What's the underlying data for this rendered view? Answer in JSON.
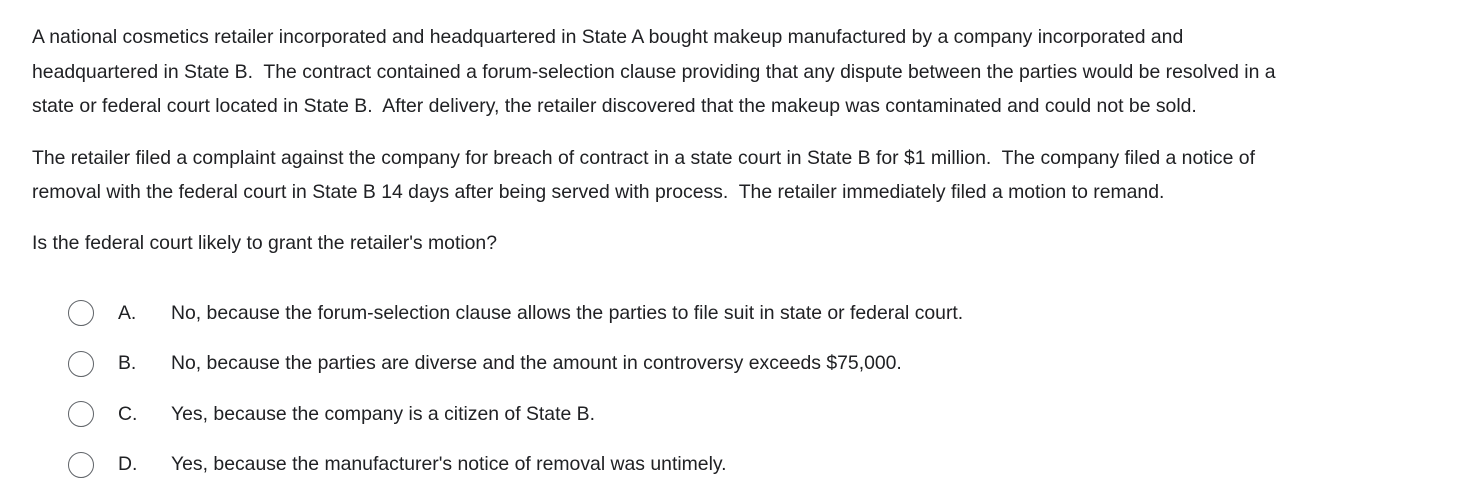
{
  "question": {
    "paragraphs": [
      "A national cosmetics retailer incorporated and headquartered in State A bought makeup manufactured by a company incorporated and\nheadquartered in State B.  The contract contained a forum-selection clause providing that any dispute between the parties would be resolved in a\nstate or federal court located in State B.  After delivery, the retailer discovered that the makeup was contaminated and could not be sold.",
      "The retailer filed a complaint against the company for breach of contract in a state court in State B for $1 million.  The company filed a notice of\nremoval with the federal court in State B 14 days after being served with process.  The retailer immediately filed a motion to remand."
    ],
    "prompt": "Is the federal court likely to grant the retailer's motion?"
  },
  "options": [
    {
      "letter": "A.",
      "text": "No, because the forum-selection clause allows the parties to file suit in state or federal court."
    },
    {
      "letter": "B.",
      "text": "No, because the parties are diverse and the amount in controversy exceeds $75,000."
    },
    {
      "letter": "C.",
      "text": "Yes, because the company is a citizen of State B."
    },
    {
      "letter": "D.",
      "text": "Yes, because the manufacturer's notice of removal was untimely."
    }
  ]
}
